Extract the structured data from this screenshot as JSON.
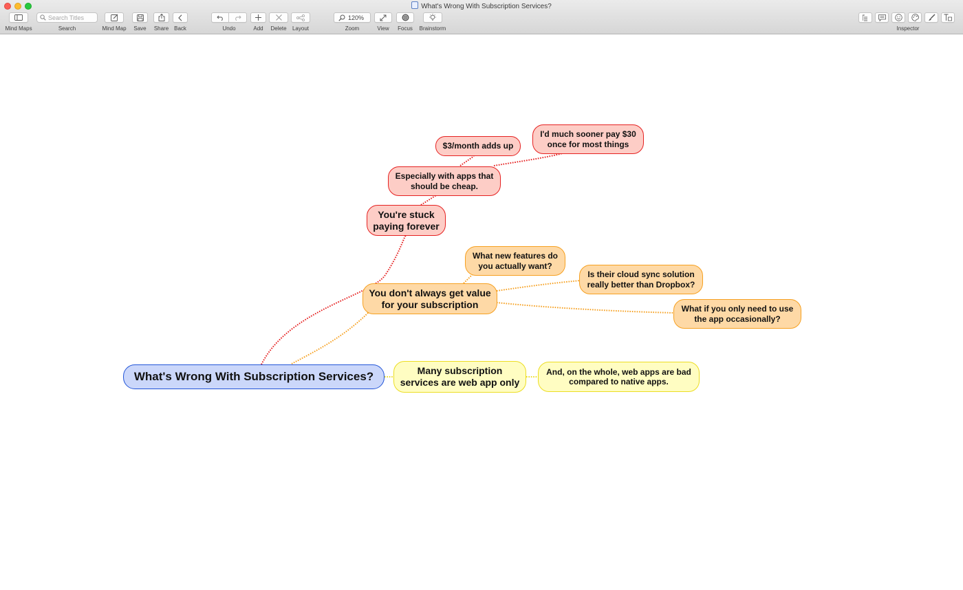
{
  "window": {
    "title": "What's Wrong With Subscription Services?"
  },
  "toolbar": {
    "mind_maps_label": "Mind Maps",
    "search_label": "Search",
    "search_placeholder": "Search Titles",
    "mind_map_label": "Mind Map",
    "save_label": "Save",
    "share_label": "Share",
    "back_label": "Back",
    "undo_label": "Undo",
    "add_label": "Add",
    "delete_label": "Delete",
    "layout_label": "Layout",
    "zoom_label": "Zoom",
    "zoom_value": "120%",
    "view_label": "View",
    "focus_label": "Focus",
    "brainstorm_label": "Brainstorm",
    "inspector_label": "Inspector"
  },
  "colors": {
    "root": "#cbd7fa",
    "red_branch": "#e52020",
    "orange_branch": "#f6a020",
    "yellow_branch": "#ecdd22"
  },
  "mindmap": {
    "root": "What's Wrong With Subscription Services?",
    "stuck": "You're stuck paying forever",
    "especially_cheap": "Especially with apps that should be cheap.",
    "three_month": "$3/month adds up",
    "pay_30": "I'd much sooner pay $30 once for most things",
    "value": "You don't always get value for your subscription",
    "new_features": "What new features do you actually want?",
    "cloud_sync": "Is their cloud sync solution really better than Dropbox?",
    "occasionally": "What if you only need to use the app occasionally?",
    "web_only": "Many subscription services are web app only",
    "web_bad": "And, on the whole, web apps are bad compared to native apps."
  }
}
